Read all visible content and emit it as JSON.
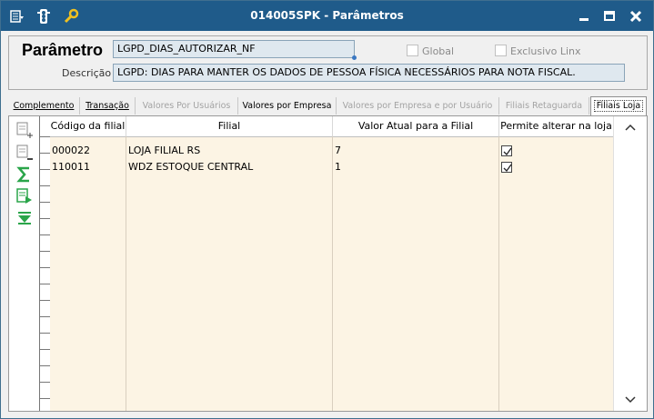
{
  "window": {
    "title": "014005SPK - Parâmetros",
    "controls": [
      "minimize",
      "maximize",
      "close"
    ]
  },
  "titlebar_icons": [
    "menu-icon",
    "traffic-light-icon",
    "wrench-icon"
  ],
  "param": {
    "label": "Parâmetro",
    "value": "LGPD_DIAS_AUTORIZAR_NF",
    "global_label": "Global",
    "global_checked": false,
    "exclusive_label": "Exclusivo Linx",
    "exclusive_checked": false,
    "description_label": "Descrição",
    "description_value": "LGPD: DIAS PARA MANTER OS DADOS DE PESSOA FÍSICA NECESSÁRIOS PARA NOTA FISCAL."
  },
  "tabs": [
    {
      "label": "Complemento",
      "state": "enabled"
    },
    {
      "label": "Transação",
      "state": "enabled"
    },
    {
      "label": "Valores Por Usuários",
      "state": "disabled"
    },
    {
      "label": "Valores por Empresa",
      "state": "enabled"
    },
    {
      "label": "Valores por Empresa e por Usuário",
      "state": "disabled"
    },
    {
      "label": "Filiais Retaguarda",
      "state": "disabled"
    },
    {
      "label": "Filiais Loja",
      "state": "active"
    }
  ],
  "toolbar": [
    "add-row-icon",
    "remove-row-icon",
    "sum-icon",
    "export-icon",
    "collapse-icon"
  ],
  "grid": {
    "columns": [
      "Código da filial",
      "Filial",
      "Valor Atual para a Filial",
      "Permite alterar na loja"
    ],
    "rows": [
      {
        "codigo": "000022",
        "filial": "LOJA FILIAL RS",
        "valor": "7",
        "permite": true
      },
      {
        "codigo": "110011",
        "filial": "WDZ ESTOQUE CENTRAL",
        "valor": "1",
        "permite": true
      }
    ]
  },
  "colors": {
    "titlebar": "#1f5b8a",
    "grid_background": "#fcf4e4",
    "field_background": "#dfe8ef"
  }
}
